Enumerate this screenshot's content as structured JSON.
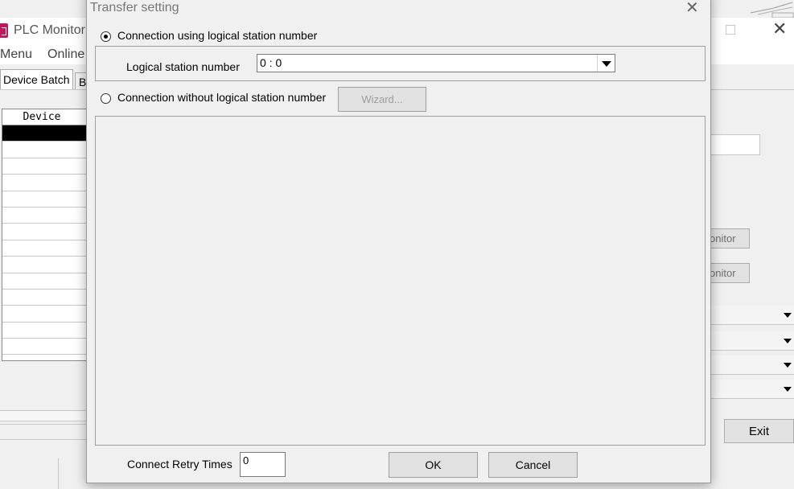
{
  "background_window": {
    "title": "PLC Monitor",
    "menu": [
      "Menu",
      "Online"
    ],
    "tabs": [
      "Device Batch",
      "B"
    ],
    "grid_header": "Device",
    "buttons": {
      "monitor_1": "onitor",
      "monitor_2": "onitor",
      "exit": "Exit"
    }
  },
  "dialog": {
    "title": "Transfer setting",
    "option_logical": "Connection using logical station number",
    "logical_station_label": "Logical station number",
    "logical_station_value": "0 : 0",
    "option_without": "Connection without logical station number",
    "wizard_label": "Wizard...",
    "retry_label": "Connect Retry Times",
    "retry_value": "0",
    "ok_label": "OK",
    "cancel_label": "Cancel"
  },
  "state": {
    "selected_option": "logical"
  },
  "colors": {
    "app_icon": "#c2185b",
    "dialog_bg": "#f0f0f0"
  }
}
